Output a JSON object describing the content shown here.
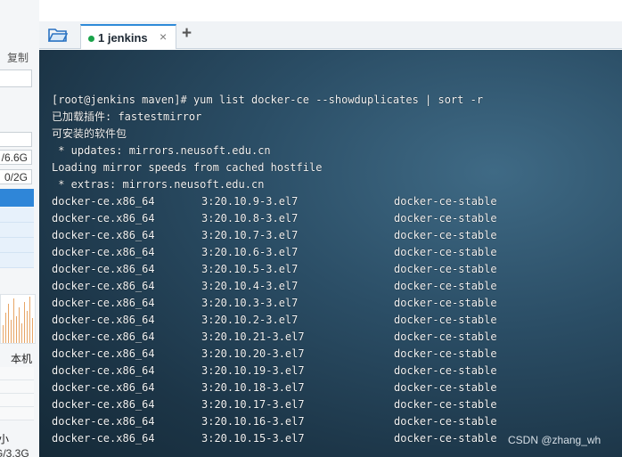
{
  "sidebar": {
    "copy_label": "复制",
    "mem1": "/6.6G",
    "mem2": "0/2G",
    "local_label": "本机",
    "small_label": "小",
    "mem3": "G/3.3G"
  },
  "tabs": {
    "items": [
      {
        "label": "1 jenkins",
        "status": "connected"
      }
    ],
    "add_label": "+",
    "close_label": "×"
  },
  "terminal": {
    "lines": [
      "[root@jenkins maven]# yum list docker-ce --showduplicates | sort -r",
      "已加载插件: fastestmirror",
      "可安装的软件包",
      " * updates: mirrors.neusoft.edu.cn",
      "Loading mirror speeds from cached hostfile",
      " * extras: mirrors.neusoft.edu.cn"
    ],
    "rows": [
      [
        "docker-ce.x86_64",
        "3:20.10.9-3.el7",
        "docker-ce-stable"
      ],
      [
        "docker-ce.x86_64",
        "3:20.10.8-3.el7",
        "docker-ce-stable"
      ],
      [
        "docker-ce.x86_64",
        "3:20.10.7-3.el7",
        "docker-ce-stable"
      ],
      [
        "docker-ce.x86_64",
        "3:20.10.6-3.el7",
        "docker-ce-stable"
      ],
      [
        "docker-ce.x86_64",
        "3:20.10.5-3.el7",
        "docker-ce-stable"
      ],
      [
        "docker-ce.x86_64",
        "3:20.10.4-3.el7",
        "docker-ce-stable"
      ],
      [
        "docker-ce.x86_64",
        "3:20.10.3-3.el7",
        "docker-ce-stable"
      ],
      [
        "docker-ce.x86_64",
        "3:20.10.2-3.el7",
        "docker-ce-stable"
      ],
      [
        "docker-ce.x86_64",
        "3:20.10.21-3.el7",
        "docker-ce-stable"
      ],
      [
        "docker-ce.x86_64",
        "3:20.10.20-3.el7",
        "docker-ce-stable"
      ],
      [
        "docker-ce.x86_64",
        "3:20.10.19-3.el7",
        "docker-ce-stable"
      ],
      [
        "docker-ce.x86_64",
        "3:20.10.18-3.el7",
        "docker-ce-stable"
      ],
      [
        "docker-ce.x86_64",
        "3:20.10.17-3.el7",
        "docker-ce-stable"
      ],
      [
        "docker-ce.x86_64",
        "3:20.10.16-3.el7",
        "docker-ce-stable"
      ],
      [
        "docker-ce.x86_64",
        "3:20.10.15-3.el7",
        "docker-ce-stable"
      ]
    ]
  },
  "watermark": "CSDN @zhang_wh",
  "colors": {
    "accent": "#2e8ad8",
    "status_connected": "#19a34a",
    "terminal_bg": "#2b4e66"
  },
  "icons": {
    "folder": "folder-icon",
    "close": "close-icon",
    "add": "plus-icon"
  }
}
